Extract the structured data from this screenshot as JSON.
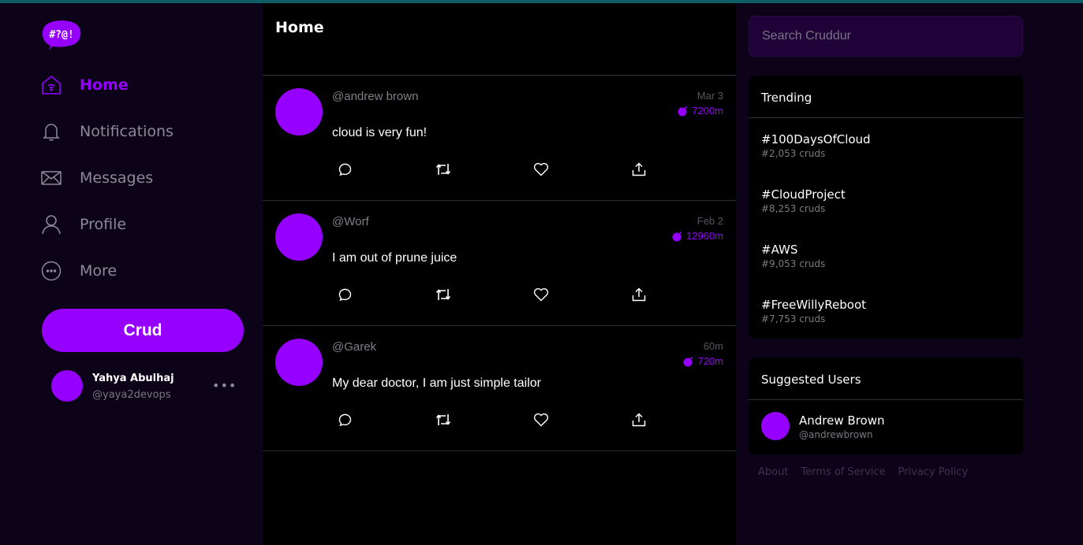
{
  "colors": {
    "accent": "#9500ff",
    "sidebar_bg": "#0c0318",
    "feed_bg": "#000000",
    "search_bg": "#1f0237"
  },
  "logo": {
    "text": "#?@!"
  },
  "nav": {
    "items": [
      {
        "label": "Home",
        "icon": "home-icon",
        "active": true
      },
      {
        "label": "Notifications",
        "icon": "bell-icon"
      },
      {
        "label": "Messages",
        "icon": "envelope-icon"
      },
      {
        "label": "Profile",
        "icon": "user-icon"
      },
      {
        "label": "More",
        "icon": "more-circle-icon"
      }
    ]
  },
  "crud_button": {
    "label": "Crud"
  },
  "profile": {
    "name": "Yahya Abulhaj",
    "handle": "@yaya2devops",
    "more": "•••"
  },
  "feed": {
    "title": "Home",
    "posts": [
      {
        "handle": "@andrew brown",
        "message": "cloud is very fun!",
        "created": "Mar 3",
        "expires": "7200m"
      },
      {
        "handle": "@Worf",
        "message": "I am out of prune juice",
        "created": "Feb 2",
        "expires": "12960m"
      },
      {
        "handle": "@Garek",
        "message": "My dear doctor, I am just simple tailor",
        "created": "60m",
        "expires": "720m"
      }
    ]
  },
  "search": {
    "placeholder": "Search Cruddur",
    "value": ""
  },
  "trending": {
    "title": "Trending",
    "items": [
      {
        "tag": "#100DaysOfCloud",
        "count": "#2,053 cruds"
      },
      {
        "tag": "#CloudProject",
        "count": "#8,253 cruds"
      },
      {
        "tag": "#AWS",
        "count": "#9,053 cruds"
      },
      {
        "tag": "#FreeWillyReboot",
        "count": "#7,753 cruds"
      }
    ]
  },
  "suggested": {
    "title": "Suggested Users",
    "users": [
      {
        "name": "Andrew Brown",
        "handle": "@andrewbrown"
      }
    ]
  },
  "footer": {
    "links": [
      "About",
      "Terms of Service",
      "Privacy Policy"
    ]
  }
}
